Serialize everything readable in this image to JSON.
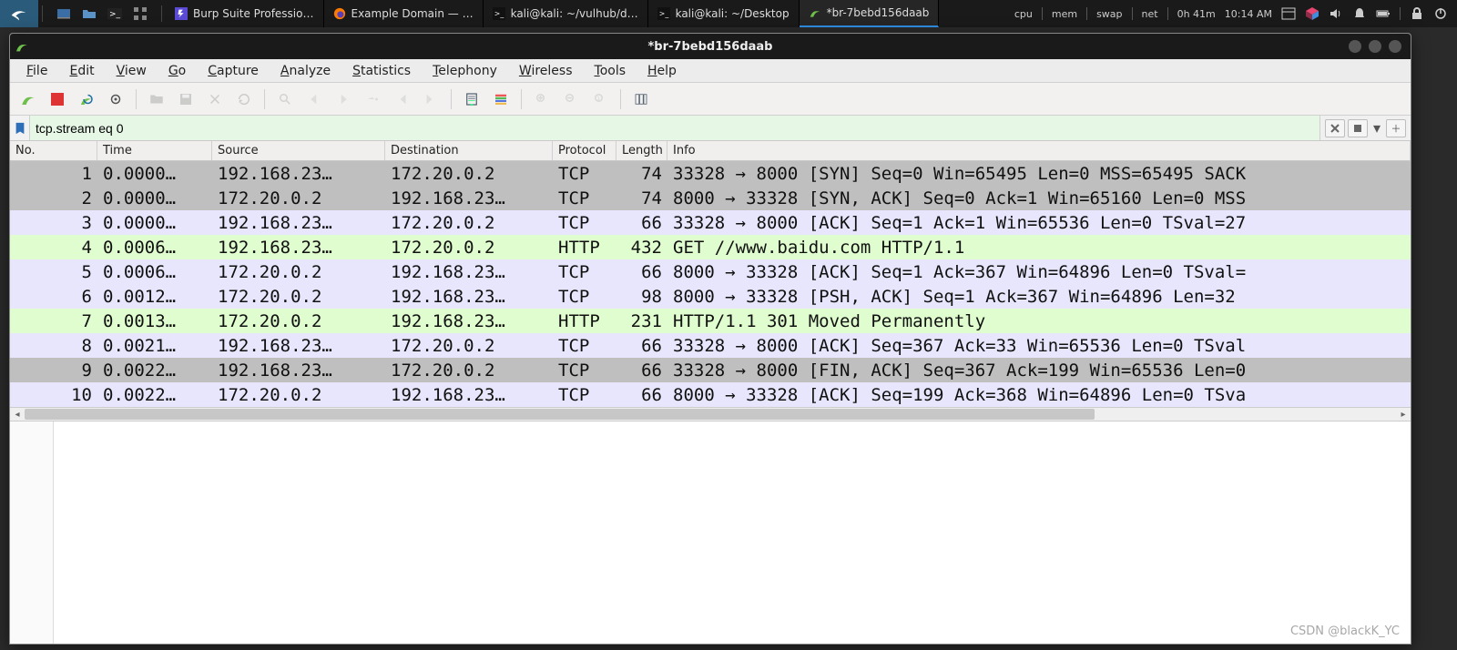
{
  "taskbar": {
    "tasks": [
      {
        "label": "Burp Suite Professio…",
        "icon": "burp"
      },
      {
        "label": "Example Domain — …",
        "icon": "firefox"
      },
      {
        "label": "kali@kali: ~/vulhub/d…",
        "icon": "terminal"
      },
      {
        "label": "kali@kali: ~/Desktop",
        "icon": "terminal"
      },
      {
        "label": "*br-7bebd156daab",
        "icon": "wireshark",
        "active": true
      }
    ],
    "tray": {
      "cpu": "cpu",
      "mem": "mem",
      "swap": "swap",
      "net": "net",
      "uptime": "0h 41m",
      "clock": "10:14 AM"
    }
  },
  "window": {
    "title": "*br-7bebd156daab"
  },
  "menu": [
    "File",
    "Edit",
    "View",
    "Go",
    "Capture",
    "Analyze",
    "Statistics",
    "Telephony",
    "Wireless",
    "Tools",
    "Help"
  ],
  "filter": {
    "value": "tcp.stream eq 0"
  },
  "columns": [
    "No.",
    "Time",
    "Source",
    "Destination",
    "Protocol",
    "Length",
    "Info"
  ],
  "packets": [
    {
      "no": "1",
      "time": "0.0000…",
      "src": "192.168.23…",
      "dst": "172.20.0.2",
      "proto": "TCP",
      "len": "74",
      "info": "33328 → 8000 [SYN] Seq=0 Win=65495 Len=0 MSS=65495 SACK",
      "cls": "row-gray"
    },
    {
      "no": "2",
      "time": "0.0000…",
      "src": "172.20.0.2",
      "dst": "192.168.23…",
      "proto": "TCP",
      "len": "74",
      "info": "8000 → 33328 [SYN, ACK] Seq=0 Ack=1 Win=65160 Len=0 MSS",
      "cls": "row-gray"
    },
    {
      "no": "3",
      "time": "0.0000…",
      "src": "192.168.23…",
      "dst": "172.20.0.2",
      "proto": "TCP",
      "len": "66",
      "info": "33328 → 8000 [ACK] Seq=1 Ack=1 Win=65536 Len=0 TSval=27",
      "cls": "row-lav"
    },
    {
      "no": "4",
      "time": "0.0006…",
      "src": "192.168.23…",
      "dst": "172.20.0.2",
      "proto": "HTTP",
      "len": "432",
      "info": "GET //www.baidu.com HTTP/1.1",
      "cls": "row-grn"
    },
    {
      "no": "5",
      "time": "0.0006…",
      "src": "172.20.0.2",
      "dst": "192.168.23…",
      "proto": "TCP",
      "len": "66",
      "info": "8000 → 33328 [ACK] Seq=1 Ack=367 Win=64896 Len=0 TSval=",
      "cls": "row-lav"
    },
    {
      "no": "6",
      "time": "0.0012…",
      "src": "172.20.0.2",
      "dst": "192.168.23…",
      "proto": "TCP",
      "len": "98",
      "info": "8000 → 33328 [PSH, ACK] Seq=1 Ack=367 Win=64896 Len=32",
      "cls": "row-lav"
    },
    {
      "no": "7",
      "time": "0.0013…",
      "src": "172.20.0.2",
      "dst": "192.168.23…",
      "proto": "HTTP",
      "len": "231",
      "info": "HTTP/1.1 301 Moved Permanently",
      "cls": "row-grn"
    },
    {
      "no": "8",
      "time": "0.0021…",
      "src": "192.168.23…",
      "dst": "172.20.0.2",
      "proto": "TCP",
      "len": "66",
      "info": "33328 → 8000 [ACK] Seq=367 Ack=33 Win=65536 Len=0 TSval",
      "cls": "row-lav"
    },
    {
      "no": "9",
      "time": "0.0022…",
      "src": "192.168.23…",
      "dst": "172.20.0.2",
      "proto": "TCP",
      "len": "66",
      "info": "33328 → 8000 [FIN, ACK] Seq=367 Ack=199 Win=65536 Len=0",
      "cls": "row-gray"
    },
    {
      "no": "10",
      "time": "0.0022…",
      "src": "172.20.0.2",
      "dst": "192.168.23…",
      "proto": "TCP",
      "len": "66",
      "info": "8000 → 33328 [ACK] Seq=199 Ack=368 Win=64896 Len=0 TSva",
      "cls": "row-lav"
    }
  ],
  "watermark": "CSDN @blackK_YC"
}
